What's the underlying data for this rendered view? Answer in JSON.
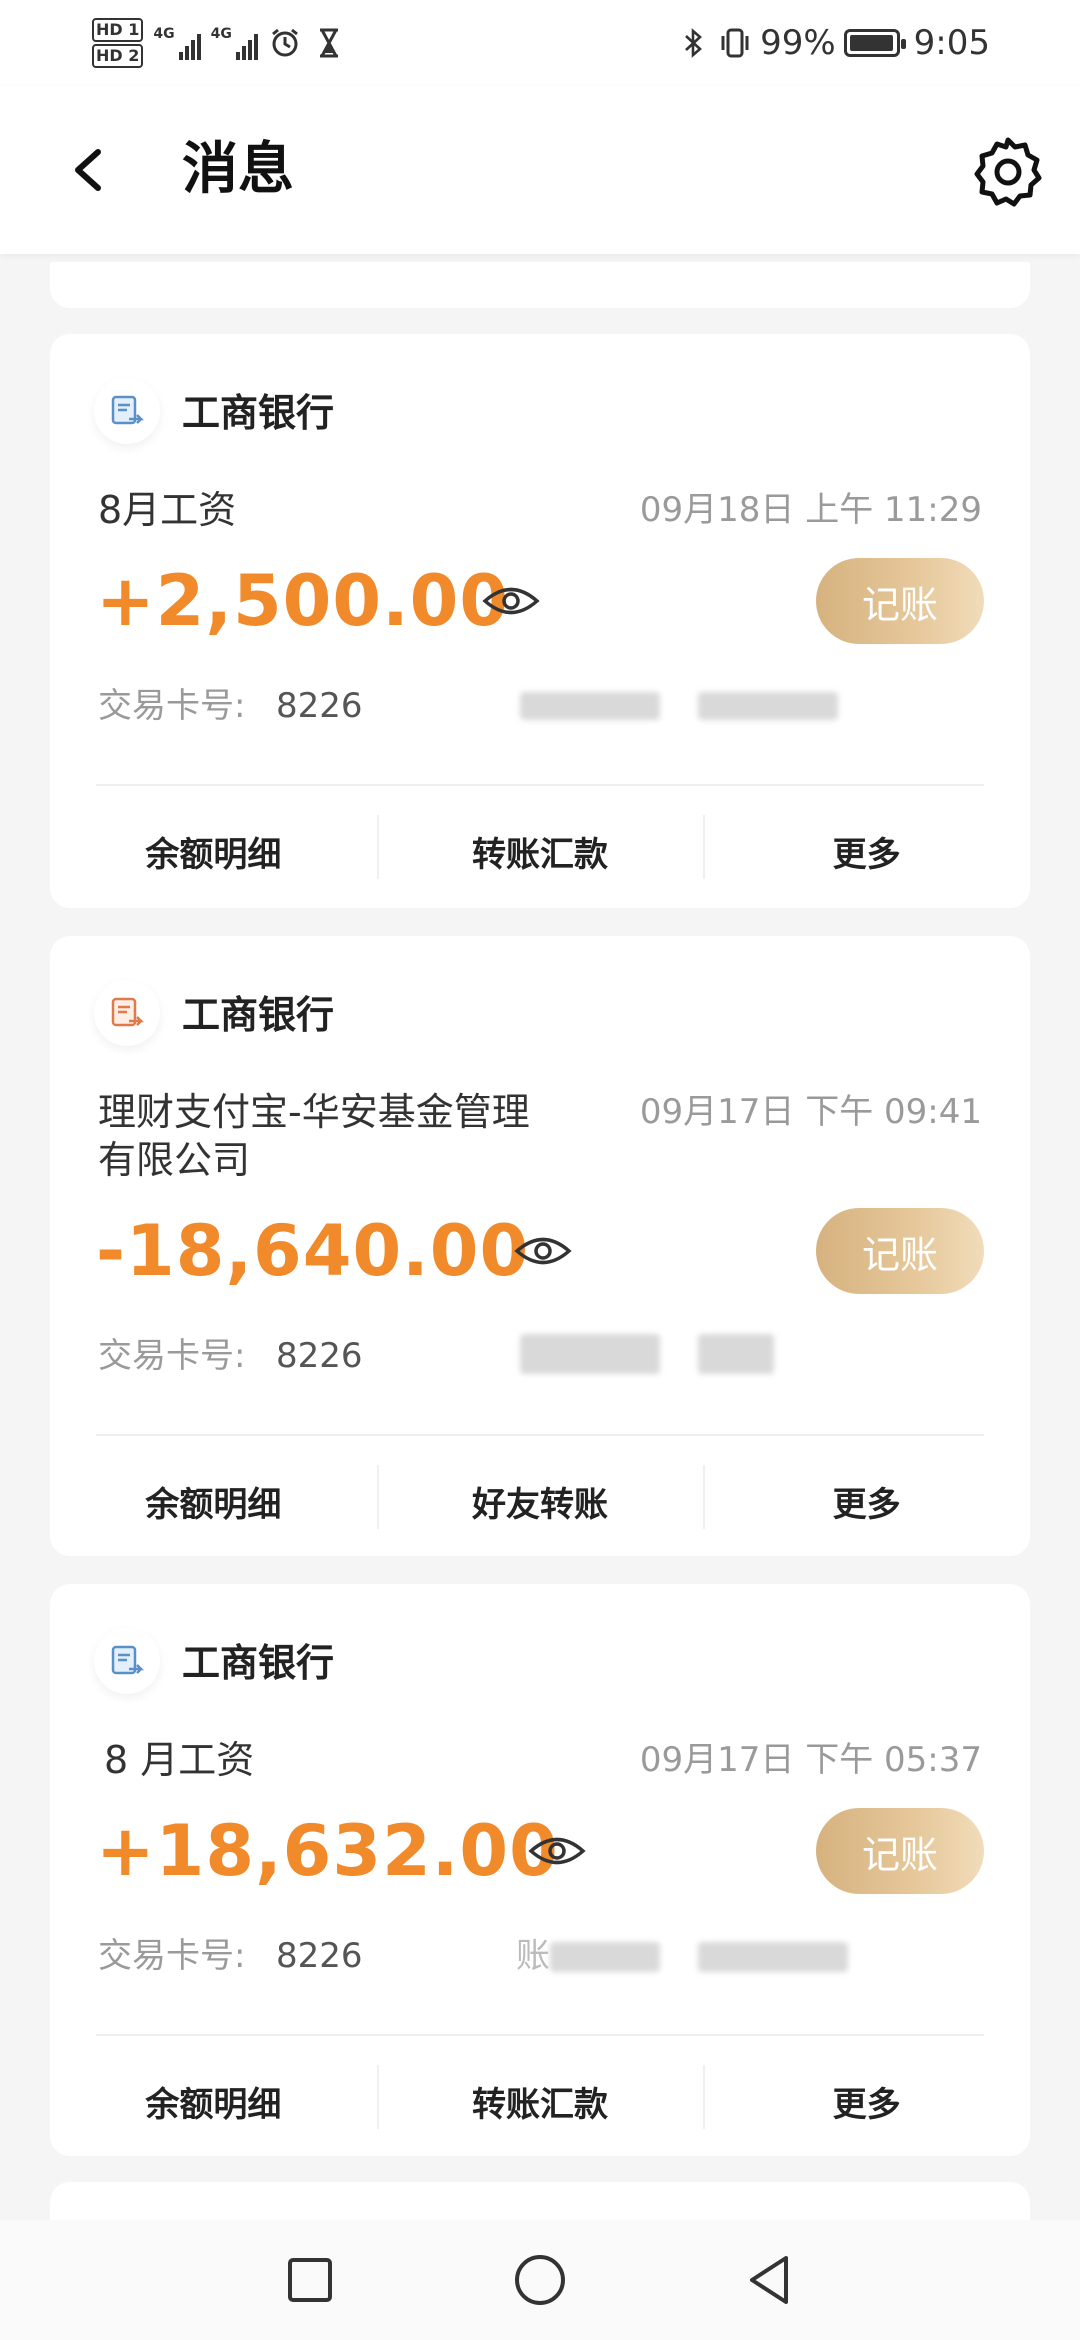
{
  "status_bar": {
    "hd1": "HD 1",
    "hd2": "HD 2",
    "signal1": "4G",
    "signal2": "4G",
    "battery_text": "99%",
    "battery_level": 0.99,
    "time": "9:05",
    "icons": [
      "alarm-icon",
      "hourglass-icon",
      "bluetooth-icon",
      "vibrate-icon"
    ]
  },
  "header": {
    "title": "消息",
    "back_icon": "chevron-left-icon",
    "settings_icon": "gear-icon"
  },
  "accent_color": "#f08a2b",
  "record_button_color": "#d6b27f",
  "messages": [
    {
      "bank": "工商银行",
      "title": "8月工资",
      "time": "09月18日 上午 11:29",
      "amount": "+2,500.00",
      "record_label": "记账",
      "card_label": "交易卡号:",
      "card_number": "8226",
      "actions": [
        "余额明细",
        "转账汇款",
        "更多"
      ]
    },
    {
      "bank": "工商银行",
      "title_line1": "理财支付宝-华安基金管理",
      "title_line2": "有限公司",
      "time": "09月17日 下午 09:41",
      "amount": "-18,640.00",
      "record_label": "记账",
      "card_label": "交易卡号:",
      "card_number": "8226",
      "actions": [
        "余额明细",
        "好友转账",
        "更多"
      ]
    },
    {
      "bank": "工商银行",
      "title": "8 月工资",
      "time": "09月17日 下午 05:37",
      "amount": "+18,632.00",
      "record_label": "记账",
      "card_label": "交易卡号:",
      "card_number": "8226",
      "blur_prefix": "账",
      "actions": [
        "余额明细",
        "转账汇款",
        "更多"
      ]
    }
  ],
  "nav_bar": {
    "buttons": [
      "recents-square-icon",
      "home-circle-icon",
      "back-triangle-icon"
    ]
  }
}
